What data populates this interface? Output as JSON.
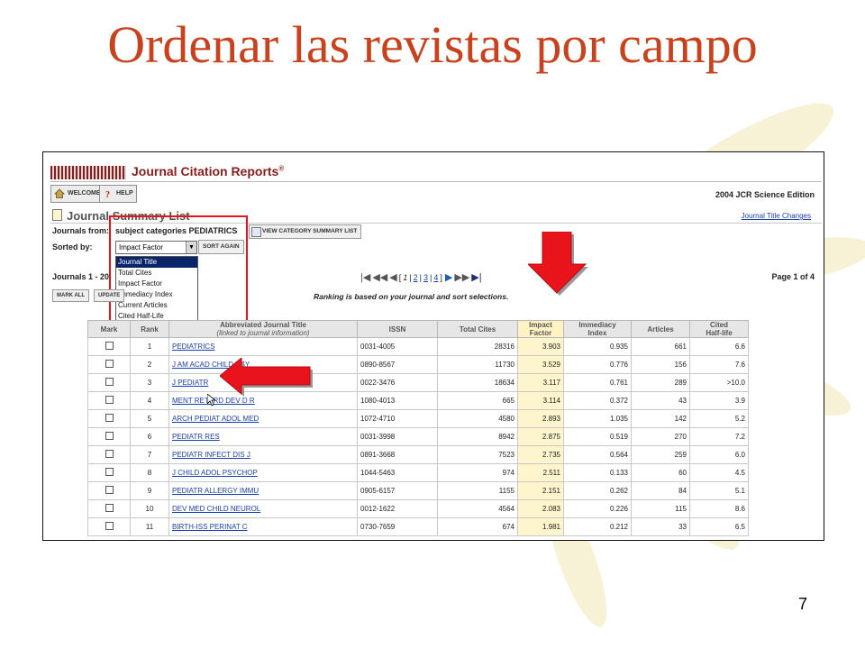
{
  "slide": {
    "title": "Ordenar las revistas por campo",
    "page_number": "7"
  },
  "jcr": {
    "app_title": "Journal Citation Reports",
    "app_title_mark": "®",
    "welcome_label": "WELCOME",
    "help_label": "HELP",
    "edition": "2004 JCR Science Edition",
    "summary_title": "Journal Summary List",
    "title_changes_link": "Journal Title Changes",
    "journals_from_label": "Journals from:",
    "subject_text": "subject categories PEDIATRICS",
    "view_category_label": "VIEW CATEGORY SUMMARY LIST",
    "sorted_by_label": "Sorted by:",
    "sort_selected": "Impact Factor",
    "sort_again_label": "SORT AGAIN",
    "sort_options": [
      "Journal Title",
      "Total Cites",
      "Impact Factor",
      "Immediacy Index",
      "Current Articles",
      "Cited Half-Life"
    ],
    "sort_highlighted": "Journal Title",
    "journals_range": "Journals 1 - 20",
    "mark_all_label": "MARK ALL",
    "update_label": "UPDATE",
    "pager": {
      "open": "[",
      "current": "1",
      "links": [
        "2",
        "3",
        "4"
      ],
      "close": "]",
      "sep": "|"
    },
    "page_of": "Page 1 of 4",
    "ranking_note": "Ranking is based on your journal and sort selections."
  },
  "table": {
    "headers": {
      "mark": "Mark",
      "rank": "Rank",
      "title_main": "Abbreviated Journal Title",
      "title_sub": "(linked to journal information)",
      "issn": "ISSN",
      "total_cites": "Total Cites",
      "impact_1": "Impact",
      "impact_2": "Factor",
      "immediacy_1": "Immediacy",
      "immediacy_2": "Index",
      "articles": "Articles",
      "half_1": "Cited",
      "half_2": "Half-life"
    },
    "rows": [
      {
        "rank": "1",
        "title": "PEDIATRICS",
        "issn": "0031-4005",
        "cites": "28316",
        "impact": "3.903",
        "immediacy": "0.935",
        "articles": "661",
        "half_life": "6.6"
      },
      {
        "rank": "2",
        "title": "J AM ACAD CHILD PSY",
        "issn": "0890-8567",
        "cites": "11730",
        "impact": "3.529",
        "immediacy": "0.776",
        "articles": "156",
        "half_life": "7.6"
      },
      {
        "rank": "3",
        "title": "J PEDIATR",
        "issn": "0022-3476",
        "cites": "18634",
        "impact": "3.117",
        "immediacy": "0.761",
        "articles": "289",
        "half_life": ">10.0"
      },
      {
        "rank": "4",
        "title": "MENT RETARD DEV D R",
        "issn": "1080-4013",
        "cites": "665",
        "impact": "3.114",
        "immediacy": "0.372",
        "articles": "43",
        "half_life": "3.9"
      },
      {
        "rank": "5",
        "title": "ARCH PEDIAT ADOL MED",
        "issn": "1072-4710",
        "cites": "4580",
        "impact": "2.893",
        "immediacy": "1.035",
        "articles": "142",
        "half_life": "5.2"
      },
      {
        "rank": "6",
        "title": "PEDIATR RES",
        "issn": "0031-3998",
        "cites": "8942",
        "impact": "2.875",
        "immediacy": "0.519",
        "articles": "270",
        "half_life": "7.2"
      },
      {
        "rank": "7",
        "title": "PEDIATR INFECT DIS J",
        "issn": "0891-3668",
        "cites": "7523",
        "impact": "2.735",
        "immediacy": "0.564",
        "articles": "259",
        "half_life": "6.0"
      },
      {
        "rank": "8",
        "title": "J CHILD ADOL PSYCHOP",
        "issn": "1044-5463",
        "cites": "974",
        "impact": "2.511",
        "immediacy": "0.133",
        "articles": "60",
        "half_life": "4.5"
      },
      {
        "rank": "9",
        "title": "PEDIATR ALLERGY IMMU",
        "issn": "0905-6157",
        "cites": "1155",
        "impact": "2.151",
        "immediacy": "0.262",
        "articles": "84",
        "half_life": "5.1"
      },
      {
        "rank": "10",
        "title": "DEV MED CHILD NEUROL",
        "issn": "0012-1622",
        "cites": "4564",
        "impact": "2.083",
        "immediacy": "0.226",
        "articles": "115",
        "half_life": "8.6"
      },
      {
        "rank": "11",
        "title": "BIRTH-ISS PERINAT C",
        "issn": "0730-7659",
        "cites": "674",
        "impact": "1.981",
        "immediacy": "0.212",
        "articles": "33",
        "half_life": "6.5"
      }
    ]
  },
  "colors": {
    "title": "#c8421e",
    "annotation_red": "#e8131b",
    "jcr_brand": "#8a1c1c",
    "link": "#1a3fb0",
    "impact_highlight": "#fff5cc"
  }
}
